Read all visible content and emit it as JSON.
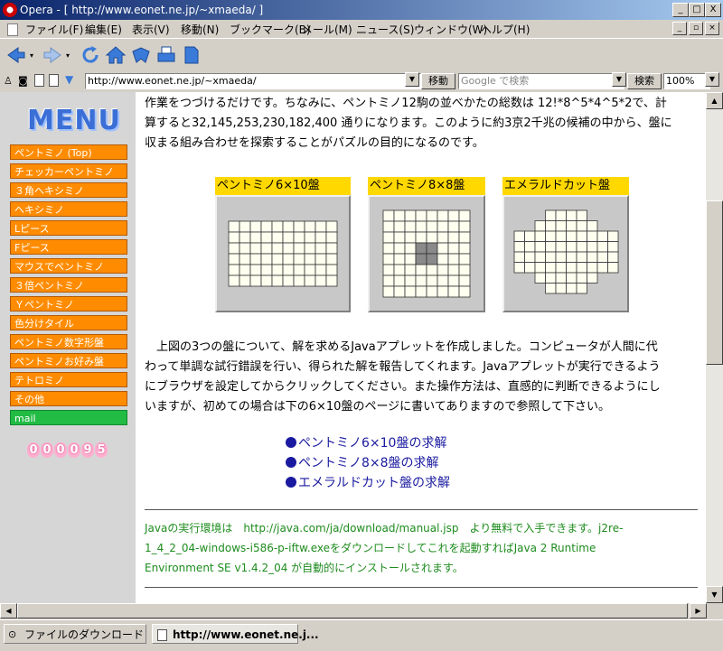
{
  "window": {
    "title": "Opera - [ http://www.eonet.ne.jp/~xmaeda/ ]",
    "controls": [
      "_",
      "□",
      "X"
    ]
  },
  "menubar": [
    "ファイル(F)",
    "編集(E)",
    "表示(V)",
    "移動(N)",
    "ブックマーク(B)",
    "メール(M)",
    "ニュース(S)",
    "ウィンドウ(W)",
    "ヘルプ(H)"
  ],
  "address": {
    "url": "http://www.eonet.ne.jp/~xmaeda/",
    "go_label": "移動",
    "search_placeholder": "Google で検索",
    "search_label": "検索",
    "zoom": "100%"
  },
  "sidebar": {
    "logo": "MENU",
    "items": [
      {
        "label": "ペントミノ (Top)"
      },
      {
        "label": "チェッカーペントミノ"
      },
      {
        "label": "３角ヘキシミノ"
      },
      {
        "label": "ヘキシミノ"
      },
      {
        "label": "Lピース"
      },
      {
        "label": "Fピース"
      },
      {
        "label": "マウスでペントミノ"
      },
      {
        "label": "３倍ペントミノ"
      },
      {
        "label": "Ｙペントミノ"
      },
      {
        "label": "色分けタイル"
      },
      {
        "label": "ペントミノ数字形盤"
      },
      {
        "label": "ペントミノお好み盤"
      },
      {
        "label": "テトロミノ"
      },
      {
        "label": "その他"
      },
      {
        "label": "mail"
      }
    ],
    "counter": [
      "0",
      "0",
      "0",
      "0",
      "9",
      "5"
    ]
  },
  "content": {
    "intro_lines": [
      "作業をつづけるだけです。ちなみに、ペントミノ12駒の並べかたの総数は 12!*8^5*4^5*2で、計",
      "算すると32,145,253,230,182,400 通りになります。このように約3京2千兆の候補の中から、盤に",
      "収まる組み合わせを探索することがパズルの目的になるのです。"
    ],
    "boards": [
      {
        "title": "ペントミノ6×10盤"
      },
      {
        "title": "ペントミノ8×8盤"
      },
      {
        "title": "エメラルドカット盤"
      }
    ],
    "desc_lines": [
      "　上図の3つの盤について、解を求めるJavaアプレットを作成しました。コンピュータが人間に代",
      "わって単調な試行錯誤を行い、得られた解を報告してくれます。Javaアプレットが実行できるよう",
      "にブラウザを設定してからクリックしてください。また操作方法は、直感的に判断できるようにし",
      "いますが、初めての場合は下の6×10盤のページに書いてありますので参照して下さい。"
    ],
    "links": [
      "ペントミノ6×10盤の求解",
      "ペントミノ8×8盤の求解",
      "エメラルドカット盤の求解"
    ],
    "java_lines": [
      "Javaの実行環境は　http://java.com/ja/download/manual.jsp　より無料で入手できます。j2re-",
      "1_4_2_04-windows-i586-p-iftw.exeをダウンロードしてこれを起動すればJava 2 Runtime",
      "Environment SE v1.4.2_04 が自動的にインストールされます。"
    ]
  },
  "statusbar": {
    "downloads": "ファイルのダウンロード",
    "active_tab": "http://www.eonet.ne.j..."
  }
}
